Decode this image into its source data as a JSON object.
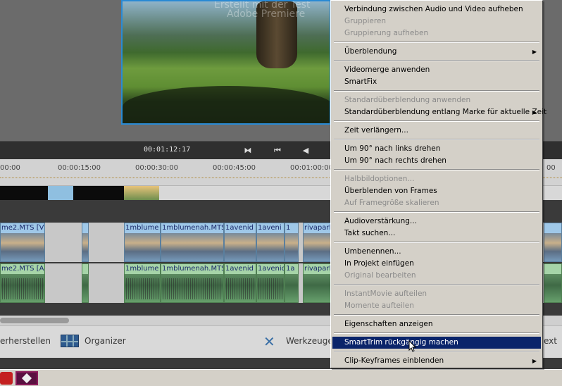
{
  "preview": {
    "watermark_line1": "Erstellt mit der Test",
    "watermark_line2": "Adobe Premiere"
  },
  "transport": {
    "timecode": "00:01:12:17",
    "btn_trim": "⧓",
    "btn_start": "⏮",
    "btn_back": "◀"
  },
  "ruler": {
    "ticks": [
      "00:00",
      "00:00:15:00",
      "00:00:30:00",
      "00:00:45:00",
      "00:01:00:00",
      "00"
    ]
  },
  "video_clips": [
    {
      "label": "me2.MTS [V"
    },
    {
      "label": ""
    },
    {
      "label": "1mblume"
    },
    {
      "label": "1mblumenah.MTS"
    },
    {
      "label": "1avenid"
    },
    {
      "label": "1aveni"
    },
    {
      "label": "1"
    },
    {
      "label": "rivapark"
    }
  ],
  "audio_clips": [
    {
      "label": "me2.MTS [A"
    },
    {
      "label": ""
    },
    {
      "label": "1mblume"
    },
    {
      "label": "1mblumenah.MTS"
    },
    {
      "label": "1avenid"
    },
    {
      "label": "1avenid"
    },
    {
      "label": "1a"
    },
    {
      "label": "rivapark"
    }
  ],
  "bottombar": {
    "restore": "erherstellen",
    "organizer": "Organizer",
    "tools": "Werkzeuge",
    "text": "ext"
  },
  "menu": {
    "items": [
      {
        "label": "Verbindung zwischen Audio und Video aufheben",
        "enabled": true
      },
      {
        "label": "Gruppieren",
        "enabled": false
      },
      {
        "label": "Gruppierung aufheben",
        "enabled": false
      },
      {
        "label": "Überblendung",
        "enabled": true,
        "submenu": true
      },
      {
        "label": "Videomerge anwenden",
        "enabled": true
      },
      {
        "label": "SmartFix",
        "enabled": true
      },
      {
        "label": "Standardüberblendung anwenden",
        "enabled": false
      },
      {
        "label": "Standardüberblendung entlang Marke für aktuelle Zeit",
        "enabled": true,
        "submenu": true
      },
      {
        "label": "Zeit verlängern...",
        "enabled": true
      },
      {
        "label": "Um 90° nach links drehen",
        "enabled": true
      },
      {
        "label": "Um 90° nach rechts drehen",
        "enabled": true
      },
      {
        "label": "Halbbildoptionen...",
        "enabled": false
      },
      {
        "label": "Überblenden von Frames",
        "enabled": true
      },
      {
        "label": "Auf Framegröße skalieren",
        "enabled": false
      },
      {
        "label": "Audioverstärkung...",
        "enabled": true
      },
      {
        "label": "Takt suchen...",
        "enabled": true
      },
      {
        "label": "Umbenennen...",
        "enabled": true
      },
      {
        "label": "In Projekt einfügen",
        "enabled": true
      },
      {
        "label": "Original bearbeiten",
        "enabled": false
      },
      {
        "label": "InstantMovie aufteilen",
        "enabled": false
      },
      {
        "label": "Momente aufteilen",
        "enabled": false
      },
      {
        "label": "Eigenschaften anzeigen",
        "enabled": true
      },
      {
        "label": "SmartTrim rückgängig machen",
        "enabled": true,
        "selected": true
      },
      {
        "label": "Clip-Keyframes einblenden",
        "enabled": true,
        "submenu": true
      }
    ],
    "submenu_arrow": "▶"
  }
}
